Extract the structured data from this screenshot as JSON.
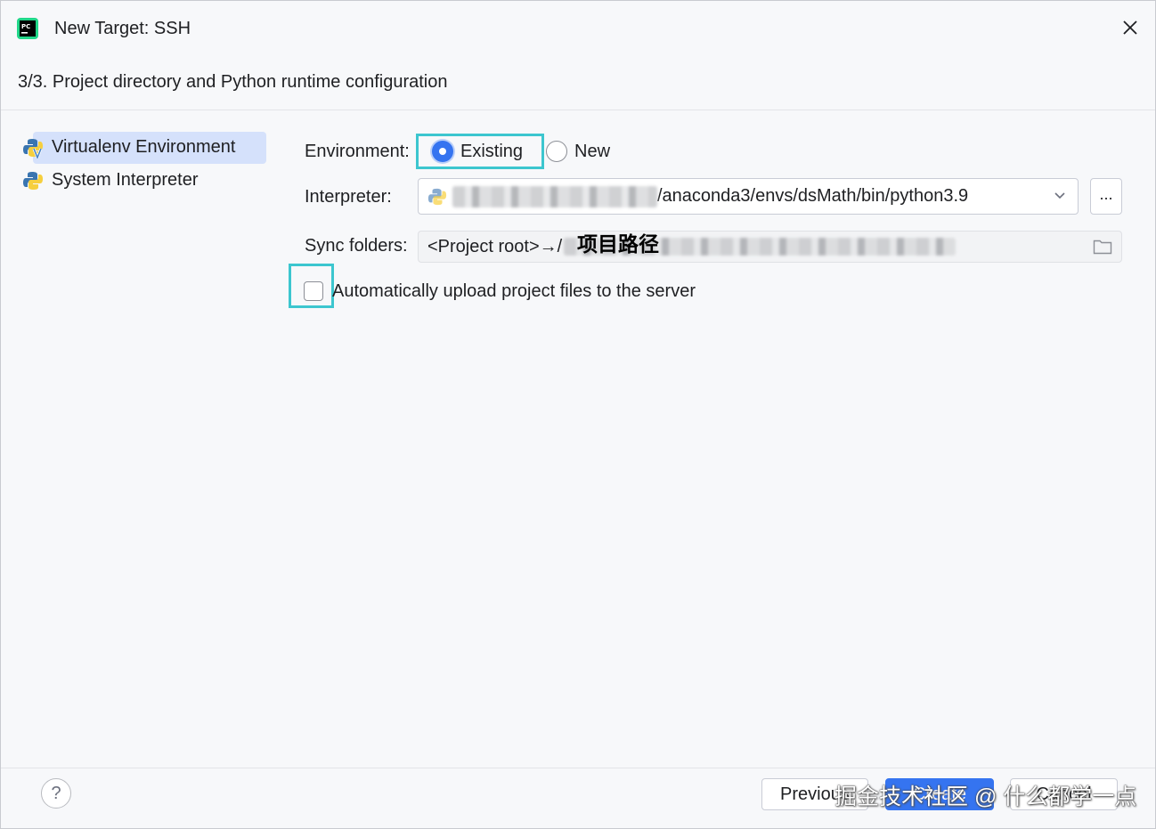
{
  "window": {
    "title": "New Target: SSH",
    "step_title": "3/3. Project directory and Python runtime configuration"
  },
  "sidebar": {
    "items": [
      {
        "label": "Virtualenv Environment",
        "selected": true,
        "icon": "python-virtualenv-icon"
      },
      {
        "label": "System Interpreter",
        "selected": false,
        "icon": "python-icon"
      }
    ]
  },
  "form": {
    "environment_label": "Environment:",
    "env_options": [
      {
        "label": "Existing",
        "checked": true
      },
      {
        "label": "New",
        "checked": false
      }
    ],
    "interpreter_label": "Interpreter:",
    "interpreter_value": "/anaconda3/envs/dsMath/bin/python3.9",
    "browse_label": "...",
    "sync_label": "Sync folders:",
    "sync_prefix": "<Project root>→/",
    "sync_annotation": "项目路径",
    "auto_upload_label": "Automatically upload project files to the server",
    "auto_upload_checked": false
  },
  "footer": {
    "help_label": "?",
    "previous_label": "Previous",
    "create_label": "Create",
    "cancel_label": "Cancel",
    "watermark": "掘金技术社区 @ 什么都学一点"
  },
  "colors": {
    "accent": "#3574f0",
    "highlight_box": "#3cc6cf",
    "selection": "#d5e1fb"
  }
}
